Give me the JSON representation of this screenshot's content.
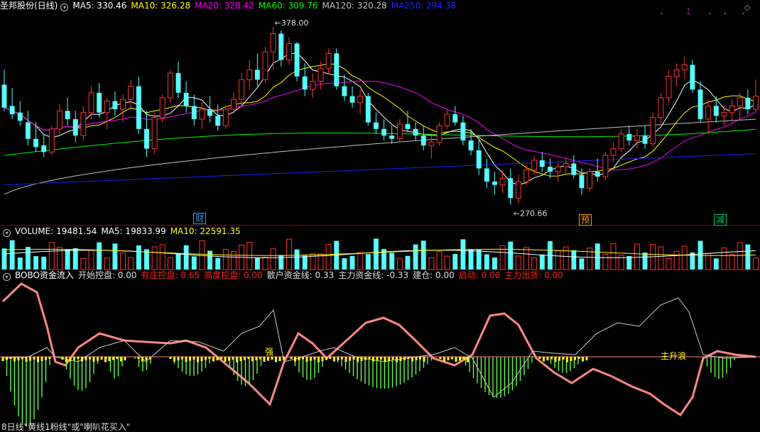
{
  "panels": {
    "main": {
      "stock": "圣邦股份(日线)",
      "indicators": [
        {
          "label": "MA5: 330.46",
          "color": "#ffffff"
        },
        {
          "label": "MA10: 326.28",
          "color": "#ffff00"
        },
        {
          "label": "MA20: 328.42",
          "color": "#ff00ff"
        },
        {
          "label": "MA60: 309.76",
          "color": "#00ff00"
        },
        {
          "label": "MA120: 320.28",
          "color": "#c0c0c0"
        },
        {
          "label": "MA250: 294.38",
          "color": "#2020ff"
        }
      ],
      "high_label": "378.00",
      "low_label": "270.66",
      "markers": [
        {
          "text": "财",
          "color": "#3399ff"
        },
        {
          "text": "预",
          "color": "#ff9900"
        },
        {
          "text": "减",
          "color": "#00cc66"
        }
      ]
    },
    "volume": {
      "title": "VOLUME: 19481.54",
      "ma5": "MA5: 19833.99",
      "ma10": "MA10: 22591.35"
    },
    "bobo": {
      "name": "BOBO资金流入",
      "items": [
        {
          "label": "开始控盘: 0.00",
          "color": "#dddddd"
        },
        {
          "label": "有庄控盘: 0.65",
          "color": "#ff2020"
        },
        {
          "label": "高度控盘: 0.00",
          "color": "#ff2020"
        },
        {
          "label": "散户资金线: 0.33",
          "color": "#dddddd"
        },
        {
          "label": "主力资金线: -0.33",
          "color": "#dddddd"
        },
        {
          "label": "建仓: 0.00",
          "color": "#dddddd"
        },
        {
          "label": "启动: 0.00",
          "color": "#ff2020"
        },
        {
          "label": "主力出货: 0.00",
          "color": "#ff2020"
        }
      ],
      "annot_strong": "强",
      "annot_wave": "主升浪"
    },
    "footer": "8日线\"黄线1粉线\"或\"喇叭花买入\""
  },
  "colors": {
    "up": "#ff3232",
    "down": "#54ffff",
    "separator": "#8b0000"
  },
  "chart_data": {
    "type": "candlestick",
    "price_range": [
      265,
      385
    ],
    "candles": [
      {
        "o": 343,
        "h": 352,
        "l": 327,
        "c": 329
      },
      {
        "o": 330,
        "h": 341,
        "l": 322,
        "c": 325
      },
      {
        "o": 326,
        "h": 333,
        "l": 318,
        "c": 321
      },
      {
        "o": 320,
        "h": 327,
        "l": 306,
        "c": 310
      },
      {
        "o": 310,
        "h": 320,
        "l": 302,
        "c": 305
      },
      {
        "o": 306,
        "h": 313,
        "l": 299,
        "c": 302
      },
      {
        "o": 302,
        "h": 318,
        "l": 300,
        "c": 316
      },
      {
        "o": 316,
        "h": 331,
        "l": 313,
        "c": 327
      },
      {
        "o": 327,
        "h": 335,
        "l": 318,
        "c": 322
      },
      {
        "o": 322,
        "h": 327,
        "l": 308,
        "c": 312
      },
      {
        "o": 312,
        "h": 330,
        "l": 309,
        "c": 326
      },
      {
        "o": 326,
        "h": 342,
        "l": 322,
        "c": 338
      },
      {
        "o": 338,
        "h": 344,
        "l": 323,
        "c": 326
      },
      {
        "o": 326,
        "h": 335,
        "l": 316,
        "c": 333
      },
      {
        "o": 333,
        "h": 339,
        "l": 324,
        "c": 328
      },
      {
        "o": 328,
        "h": 337,
        "l": 320,
        "c": 334
      },
      {
        "o": 334,
        "h": 346,
        "l": 328,
        "c": 342
      },
      {
        "o": 342,
        "h": 348,
        "l": 313,
        "c": 316
      },
      {
        "o": 316,
        "h": 327,
        "l": 299,
        "c": 304
      },
      {
        "o": 304,
        "h": 326,
        "l": 301,
        "c": 323
      },
      {
        "o": 323,
        "h": 337,
        "l": 320,
        "c": 335
      },
      {
        "o": 335,
        "h": 352,
        "l": 332,
        "c": 350
      },
      {
        "o": 350,
        "h": 357,
        "l": 335,
        "c": 338
      },
      {
        "o": 338,
        "h": 345,
        "l": 326,
        "c": 330
      },
      {
        "o": 330,
        "h": 337,
        "l": 318,
        "c": 322
      },
      {
        "o": 322,
        "h": 332,
        "l": 316,
        "c": 328
      },
      {
        "o": 328,
        "h": 336,
        "l": 320,
        "c": 324
      },
      {
        "o": 324,
        "h": 331,
        "l": 315,
        "c": 318
      },
      {
        "o": 318,
        "h": 330,
        "l": 316,
        "c": 328
      },
      {
        "o": 328,
        "h": 338,
        "l": 325,
        "c": 334
      },
      {
        "o": 334,
        "h": 350,
        "l": 330,
        "c": 346
      },
      {
        "o": 346,
        "h": 358,
        "l": 340,
        "c": 352
      },
      {
        "o": 352,
        "h": 362,
        "l": 342,
        "c": 346
      },
      {
        "o": 346,
        "h": 366,
        "l": 344,
        "c": 363
      },
      {
        "o": 363,
        "h": 378,
        "l": 352,
        "c": 374
      },
      {
        "o": 374,
        "h": 376,
        "l": 354,
        "c": 358
      },
      {
        "o": 358,
        "h": 372,
        "l": 355,
        "c": 368
      },
      {
        "o": 368,
        "h": 369,
        "l": 345,
        "c": 348
      },
      {
        "o": 348,
        "h": 356,
        "l": 336,
        "c": 340
      },
      {
        "o": 340,
        "h": 350,
        "l": 335,
        "c": 345
      },
      {
        "o": 345,
        "h": 357,
        "l": 340,
        "c": 353
      },
      {
        "o": 353,
        "h": 365,
        "l": 349,
        "c": 362
      },
      {
        "o": 362,
        "h": 365,
        "l": 340,
        "c": 342
      },
      {
        "o": 342,
        "h": 349,
        "l": 333,
        "c": 336
      },
      {
        "o": 336,
        "h": 342,
        "l": 329,
        "c": 332
      },
      {
        "o": 332,
        "h": 340,
        "l": 325,
        "c": 336
      },
      {
        "o": 336,
        "h": 338,
        "l": 318,
        "c": 320
      },
      {
        "o": 320,
        "h": 326,
        "l": 313,
        "c": 316
      },
      {
        "o": 316,
        "h": 322,
        "l": 309,
        "c": 312
      },
      {
        "o": 312,
        "h": 318,
        "l": 307,
        "c": 310
      },
      {
        "o": 310,
        "h": 322,
        "l": 308,
        "c": 319
      },
      {
        "o": 319,
        "h": 327,
        "l": 314,
        "c": 316
      },
      {
        "o": 316,
        "h": 320,
        "l": 309,
        "c": 312
      },
      {
        "o": 312,
        "h": 318,
        "l": 303,
        "c": 306
      },
      {
        "o": 306,
        "h": 312,
        "l": 298,
        "c": 308
      },
      {
        "o": 308,
        "h": 320,
        "l": 306,
        "c": 318
      },
      {
        "o": 318,
        "h": 328,
        "l": 316,
        "c": 325
      },
      {
        "o": 325,
        "h": 330,
        "l": 318,
        "c": 320
      },
      {
        "o": 320,
        "h": 324,
        "l": 306,
        "c": 309
      },
      {
        "o": 309,
        "h": 316,
        "l": 300,
        "c": 303
      },
      {
        "o": 303,
        "h": 309,
        "l": 288,
        "c": 292
      },
      {
        "o": 292,
        "h": 298,
        "l": 280,
        "c": 284
      },
      {
        "o": 284,
        "h": 290,
        "l": 276,
        "c": 282
      },
      {
        "o": 282,
        "h": 290,
        "l": 277,
        "c": 286
      },
      {
        "o": 286,
        "h": 292,
        "l": 270,
        "c": 274
      },
      {
        "o": 274,
        "h": 288,
        "l": 271,
        "c": 284
      },
      {
        "o": 284,
        "h": 294,
        "l": 282,
        "c": 291
      },
      {
        "o": 291,
        "h": 300,
        "l": 288,
        "c": 297
      },
      {
        "o": 297,
        "h": 302,
        "l": 290,
        "c": 293
      },
      {
        "o": 293,
        "h": 298,
        "l": 286,
        "c": 290
      },
      {
        "o": 290,
        "h": 296,
        "l": 284,
        "c": 293
      },
      {
        "o": 293,
        "h": 299,
        "l": 288,
        "c": 295
      },
      {
        "o": 295,
        "h": 300,
        "l": 286,
        "c": 288
      },
      {
        "o": 288,
        "h": 292,
        "l": 276,
        "c": 280
      },
      {
        "o": 280,
        "h": 292,
        "l": 278,
        "c": 290
      },
      {
        "o": 290,
        "h": 298,
        "l": 284,
        "c": 287
      },
      {
        "o": 287,
        "h": 302,
        "l": 285,
        "c": 300
      },
      {
        "o": 300,
        "h": 308,
        "l": 296,
        "c": 304
      },
      {
        "o": 304,
        "h": 316,
        "l": 302,
        "c": 313
      },
      {
        "o": 313,
        "h": 318,
        "l": 306,
        "c": 309
      },
      {
        "o": 309,
        "h": 316,
        "l": 304,
        "c": 312
      },
      {
        "o": 312,
        "h": 318,
        "l": 304,
        "c": 307
      },
      {
        "o": 307,
        "h": 326,
        "l": 305,
        "c": 323
      },
      {
        "o": 323,
        "h": 338,
        "l": 320,
        "c": 335
      },
      {
        "o": 335,
        "h": 352,
        "l": 332,
        "c": 348
      },
      {
        "o": 348,
        "h": 356,
        "l": 342,
        "c": 352
      },
      {
        "o": 352,
        "h": 360,
        "l": 346,
        "c": 355
      },
      {
        "o": 355,
        "h": 358,
        "l": 338,
        "c": 340
      },
      {
        "o": 340,
        "h": 345,
        "l": 320,
        "c": 322
      },
      {
        "o": 322,
        "h": 334,
        "l": 313,
        "c": 330
      },
      {
        "o": 330,
        "h": 336,
        "l": 320,
        "c": 324
      },
      {
        "o": 324,
        "h": 330,
        "l": 318,
        "c": 326
      },
      {
        "o": 326,
        "h": 334,
        "l": 320,
        "c": 330
      },
      {
        "o": 330,
        "h": 338,
        "l": 322,
        "c": 335
      },
      {
        "o": 335,
        "h": 340,
        "l": 325,
        "c": 328
      },
      {
        "o": 328,
        "h": 346,
        "l": 326,
        "c": 336
      }
    ],
    "ma_series": [
      "MA5",
      "MA10",
      "MA20",
      "MA60",
      "MA120",
      "MA250"
    ],
    "volume_panel": {
      "title": "VOLUME",
      "ma_labels": [
        "MA5",
        "MA10"
      ]
    },
    "bobo_panel": {
      "lines": [
        "散户资金线",
        "主力资金线"
      ]
    }
  }
}
